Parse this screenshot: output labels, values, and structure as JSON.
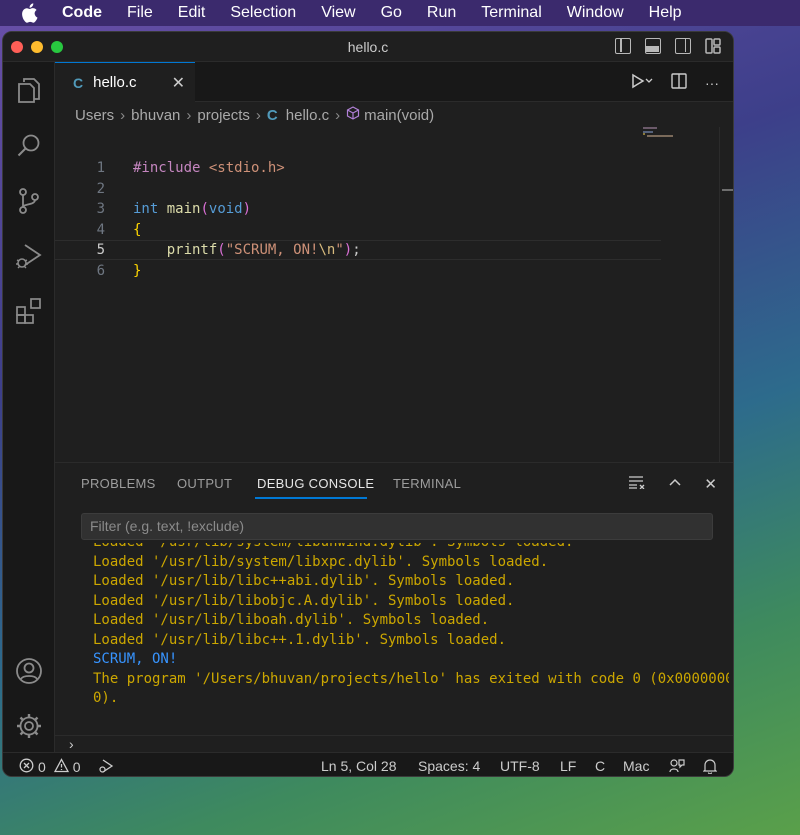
{
  "menubar": {
    "app": "Code",
    "items": [
      "File",
      "Edit",
      "Selection",
      "View",
      "Go",
      "Run",
      "Terminal",
      "Window",
      "Help"
    ]
  },
  "window": {
    "title": "hello.c"
  },
  "tab": {
    "label": "hello.c",
    "icon": "C"
  },
  "breadcrumb": {
    "items": [
      "Users",
      "bhuvan",
      "projects",
      "hello.c",
      "main(void)"
    ],
    "file_icon": "C"
  },
  "editor": {
    "active_line": 5,
    "lines": [
      {
        "n": "1",
        "parts": [
          [
            "inc",
            "#include "
          ],
          [
            "hdr",
            "<stdio.h>"
          ]
        ]
      },
      {
        "n": "2",
        "parts": []
      },
      {
        "n": "3",
        "parts": [
          [
            "type",
            "int"
          ],
          [
            "plain",
            " "
          ],
          [
            "fn",
            "main"
          ],
          [
            "par",
            "("
          ],
          [
            "type",
            "void"
          ],
          [
            "par",
            ")"
          ]
        ]
      },
      {
        "n": "4",
        "parts": [
          [
            "br",
            "{"
          ]
        ]
      },
      {
        "n": "5",
        "parts": [
          [
            "plain",
            "    "
          ],
          [
            "fn",
            "printf"
          ],
          [
            "par",
            "("
          ],
          [
            "str",
            "\"SCRUM, ON!"
          ],
          [
            "esc",
            "\\n"
          ],
          [
            "str",
            "\""
          ],
          [
            "par",
            ")"
          ],
          [
            "plain",
            ";"
          ]
        ]
      },
      {
        "n": "6",
        "parts": [
          [
            "br",
            "}"
          ]
        ]
      }
    ]
  },
  "panel": {
    "tabs": [
      "PROBLEMS",
      "OUTPUT",
      "DEBUG CONSOLE",
      "TERMINAL"
    ],
    "active_tab": "DEBUG CONSOLE",
    "filter_placeholder": "Filter (e.g. text, !exclude)",
    "console_lines": [
      {
        "type": "log",
        "text": "Loaded '/usr/lib/system/libunwind.dylib'. Symbols loaded."
      },
      {
        "type": "log",
        "text": "Loaded '/usr/lib/system/libxpc.dylib'. Symbols loaded."
      },
      {
        "type": "log",
        "text": "Loaded '/usr/lib/libc++abi.dylib'. Symbols loaded."
      },
      {
        "type": "log",
        "text": "Loaded '/usr/lib/libobjc.A.dylib'. Symbols loaded."
      },
      {
        "type": "log",
        "text": "Loaded '/usr/lib/liboah.dylib'. Symbols loaded."
      },
      {
        "type": "log",
        "text": "Loaded '/usr/lib/libc++.1.dylib'. Symbols loaded."
      },
      {
        "type": "out",
        "text": "SCRUM, ON!"
      },
      {
        "type": "log",
        "text": "The program '/Users/bhuvan/projects/hello' has exited with code 0 (0x0000000"
      },
      {
        "type": "log",
        "text": "0)."
      }
    ],
    "prompt": "›"
  },
  "statusbar": {
    "errors": "0",
    "warnings": "0",
    "position": "Ln 5, Col 28",
    "spaces": "Spaces: 4",
    "encoding": "UTF-8",
    "eol": "LF",
    "language": "C",
    "platform": "Mac"
  },
  "colors": {
    "accent": "#0078d4",
    "console_log": "#cca700",
    "console_out": "#3794ff"
  }
}
